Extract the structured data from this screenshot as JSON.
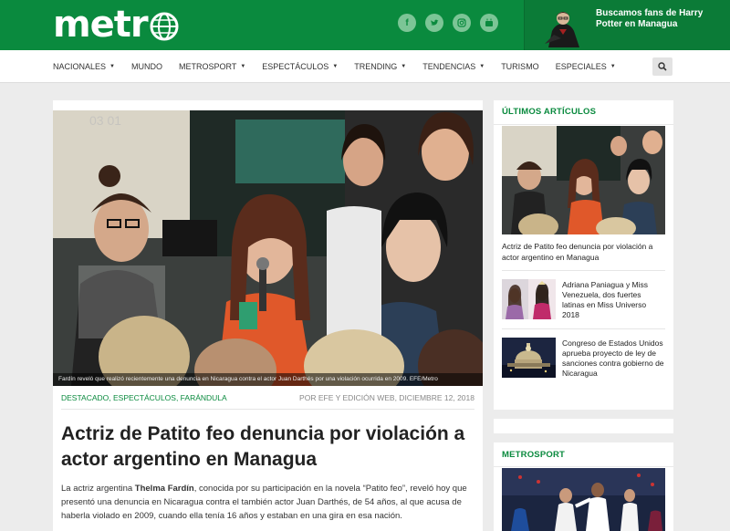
{
  "header": {
    "logo_text": "metr",
    "social_icons": [
      "facebook-icon",
      "twitter-icon",
      "instagram-icon",
      "youtube-icon"
    ],
    "promo_text": "Buscamos fans de Harry Potter en Managua"
  },
  "nav": {
    "items": [
      {
        "label": "NACIONALES",
        "dropdown": true
      },
      {
        "label": "MUNDO",
        "dropdown": false
      },
      {
        "label": "METROSPORT",
        "dropdown": true
      },
      {
        "label": "ESPECTÁCULOS",
        "dropdown": true
      },
      {
        "label": "TRENDING",
        "dropdown": true
      },
      {
        "label": "TENDENCIAS",
        "dropdown": true
      },
      {
        "label": "TURISMO",
        "dropdown": false
      },
      {
        "label": "ESPECIALES",
        "dropdown": true
      }
    ]
  },
  "article": {
    "caption": "Fardín reveló que realizó recientemente una denuncia en Nicaragua contra el actor Juan Darthés por una violación ocurrida en 2009. EFE/Metro",
    "categories": "DESTACADO, ESPECTÁCULOS, FARÁNDULA",
    "byline": "POR EFE Y EDICIÓN WEB, DICIEMBRE 12, 2018",
    "headline": "Actriz de Patito feo denuncia por violación a actor argentino en Managua",
    "body_start": "La actriz argentina ",
    "body_bold": "Thelma Fardín",
    "body_rest": ", conocida por su participación en la novela “Patito feo”, reveló hoy que presentó una denuncia en Nicaragua contra el también actor Juan Darthés, de 54 años, al que acusa de haberla violado en 2009, cuando ella tenía 16 años y estaban en una gira en esa nación."
  },
  "sidebar": {
    "latest_title": "ÚLTIMOS ARTÍCULOS",
    "featured_title": "Actriz de Patito feo denuncia por violación a actor argentino en Managua",
    "items": [
      {
        "title": "Adriana Paniagua y Miss Venezuela, dos fuertes latinas en Miss Universo 2018"
      },
      {
        "title": "Congreso de Estados Unidos aprueba proyecto de ley de sanciones contra gobierno de Nicaragua"
      }
    ],
    "sport_title": "METROSPORT"
  },
  "colors": {
    "brand_green": "#0a8a3e",
    "background": "#ececec"
  }
}
